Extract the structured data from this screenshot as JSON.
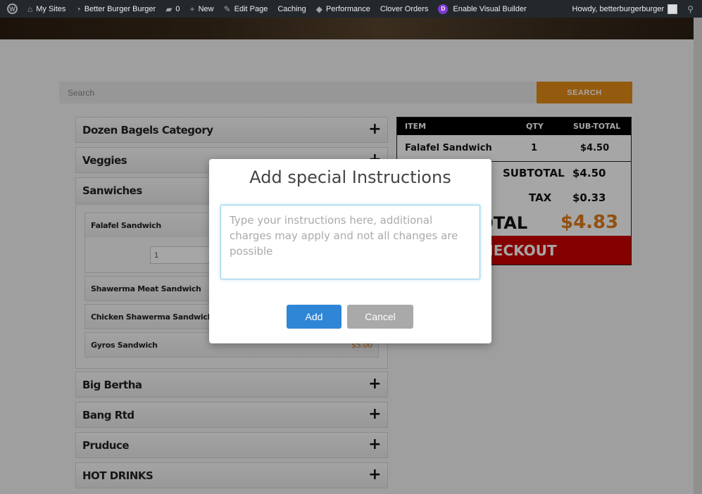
{
  "admin_bar": {
    "my_sites": "My Sites",
    "site_name": "Better Burger Burger",
    "comments_count": "0",
    "new_label": "New",
    "edit_page": "Edit Page",
    "caching": "Caching",
    "performance": "Performance",
    "clover_orders": "Clover Orders",
    "visual_builder": "Enable Visual Builder",
    "howdy": "Howdy, betterburgerburger"
  },
  "search": {
    "placeholder": "Search",
    "button_label": "SEARCH"
  },
  "categories": [
    {
      "name": "Dozen Bagels Category"
    },
    {
      "name": "Veggies"
    },
    {
      "name": "Sanwiches"
    },
    {
      "name": "Big Bertha"
    },
    {
      "name": "Bang Rtd"
    },
    {
      "name": "Pruduce"
    },
    {
      "name": "HOT DRINKS"
    }
  ],
  "products": [
    {
      "name": "Falafel Sandwich",
      "qty": "1"
    },
    {
      "name": "Shawerma Meat Sandwich"
    },
    {
      "name": "Chicken Shawerma Sandwich"
    },
    {
      "name": "Gyros Sandwich",
      "price": "$5.00"
    }
  ],
  "cart": {
    "headers": {
      "item": "ITEM",
      "qty": "QTY",
      "subtotal": "SUB-TOTAL"
    },
    "rows": [
      {
        "item": "Falafel Sandwich",
        "qty": "1",
        "subtotal": "$4.50"
      }
    ],
    "subtotal_label": "SUBTOTAL",
    "subtotal_value": "$4.50",
    "tax_label": "TAX",
    "tax_value": "$0.33",
    "total_label": "TOTAL",
    "total_value": "$4.83",
    "checkout_label": "CHECKOUT",
    "colors": {
      "total_value": "#e07b1a",
      "checkout_bg": "#cc0000"
    }
  },
  "modal": {
    "title": "Add special Instructions",
    "placeholder": "Type your instructions here, additional charges may apply and not all changes are possible",
    "add_label": "Add",
    "cancel_label": "Cancel"
  },
  "icons": [
    "wordpress-icon",
    "my-sites-icon",
    "dashboard-icon",
    "comment-icon",
    "plus-icon",
    "pencil-icon",
    "performance-icon",
    "divi-icon",
    "search-icon",
    "avatar"
  ]
}
